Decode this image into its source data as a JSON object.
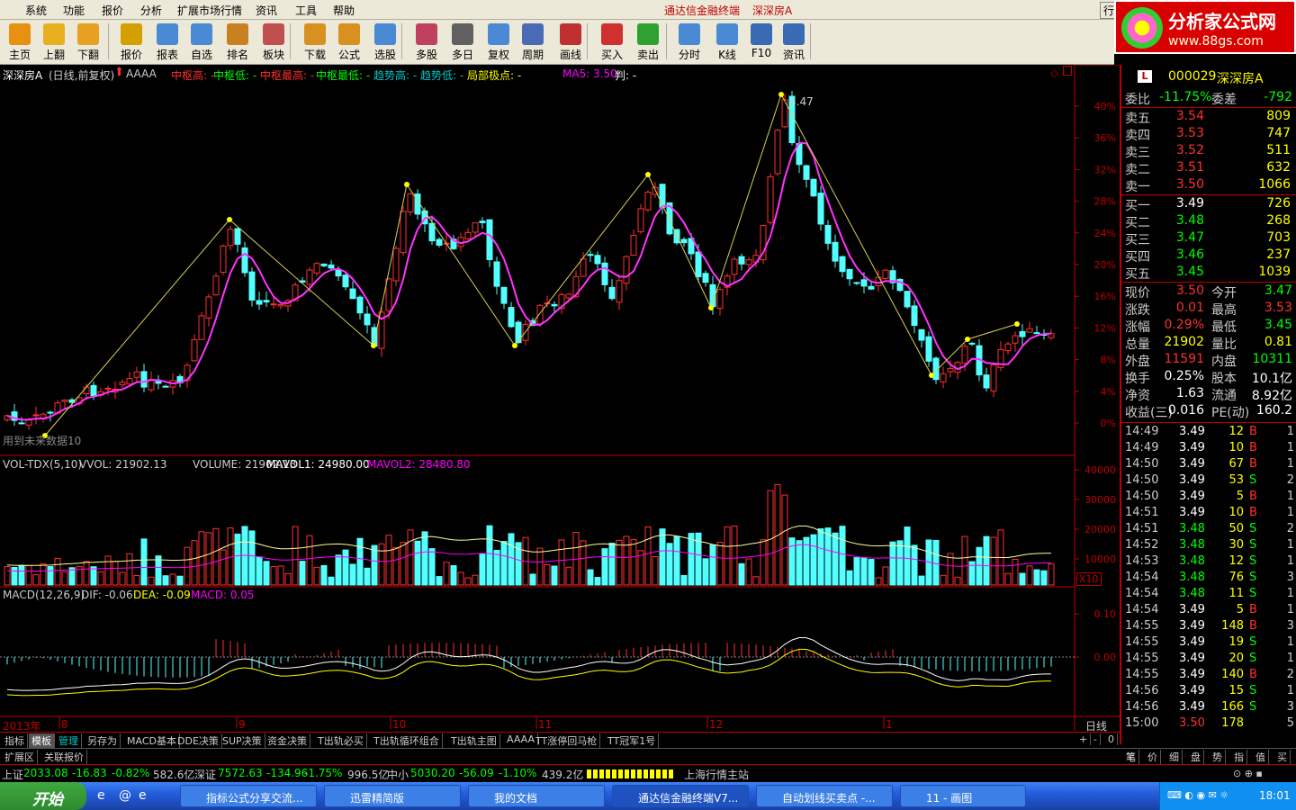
{
  "menu": [
    "系统",
    "功能",
    "报价",
    "分析",
    "扩展市场行情",
    "资讯",
    "工具",
    "帮助"
  ],
  "app_title": "通达信金融终端",
  "stock_title": "深深房A",
  "menu_right": "行",
  "logo": {
    "title": "分析家公式网",
    "url": "www.88gs.com"
  },
  "toolbar": [
    "主页",
    "上翻",
    "下翻",
    "报价",
    "报表",
    "自选",
    "排名",
    "板块",
    "下载",
    "公式",
    "选股",
    "多股",
    "多日",
    "复权",
    "周期",
    "画线",
    "买入",
    "卖出",
    "分时",
    "K线",
    "F10",
    "资讯"
  ],
  "main_chart": {
    "header_stock": "深深房A",
    "header_period": "(日线,前复权)",
    "header_formula": "AAAA",
    "indicators": [
      {
        "label": "中枢高:",
        "value": "-",
        "color": "#ff3030"
      },
      {
        "label": "中枢低:",
        "value": "-",
        "color": "#00ff00"
      },
      {
        "label": "中枢最高:",
        "value": "-",
        "color": "#ff3030"
      },
      {
        "label": "中枢最低:",
        "value": "-",
        "color": "#00ff00"
      },
      {
        "label": "趋势高:",
        "value": "-",
        "color": "#00c8c8"
      },
      {
        "label": "趋势低:",
        "value": "-",
        "color": "#00c8c8"
      },
      {
        "label": "局部极点:",
        "value": "-",
        "color": "#ffff00"
      },
      {
        "label": "MA5:",
        "value": "3.50",
        "color": "#ff00ff"
      },
      {
        "label": "判:",
        "value": "-",
        "color": "#ffffff"
      }
    ],
    "peak_label": "4.47",
    "left_note": "用到未来数据10",
    "y_ticks": [
      "40%",
      "36%",
      "32%",
      "28%",
      "24%",
      "20%",
      "16%",
      "12%",
      "8%",
      "4%",
      "0%"
    ]
  },
  "volume_chart": {
    "title": "VOL-TDX(5,10)",
    "vvol": "VVOL: 21902.13",
    "volume": "VOLUME: 21902.13",
    "mavol1": "MAVOL1: 24980.00",
    "mavol2": "MAVOL2: 28480.80",
    "y_ticks": [
      "40000",
      "30000",
      "20000",
      "10000"
    ],
    "scale": "X10"
  },
  "macd_chart": {
    "title": "MACD(12,26,9)",
    "dif": "DIF: -0.06",
    "dea": "DEA: -0.09",
    "macd": "MACD: 0.05",
    "y_ticks": [
      "0.10",
      "0.00"
    ]
  },
  "x_axis": {
    "year": "2013年",
    "months": [
      "8",
      "9",
      "10",
      "11",
      "12",
      "1"
    ],
    "period": "日线"
  },
  "quote": {
    "code": "000029",
    "name": "深深房A",
    "weibi_label": "委比",
    "weibi": "-11.75%",
    "weicha_label": "委差",
    "weicha": "-792",
    "sells": [
      {
        "label": "卖五",
        "price": "3.54",
        "vol": "809"
      },
      {
        "label": "卖四",
        "price": "3.53",
        "vol": "747"
      },
      {
        "label": "卖三",
        "price": "3.52",
        "vol": "511"
      },
      {
        "label": "卖二",
        "price": "3.51",
        "vol": "632"
      },
      {
        "label": "卖一",
        "price": "3.50",
        "vol": "1066"
      }
    ],
    "buys": [
      {
        "label": "买一",
        "price": "3.49",
        "vol": "726"
      },
      {
        "label": "买二",
        "price": "3.48",
        "vol": "268"
      },
      {
        "label": "买三",
        "price": "3.47",
        "vol": "703"
      },
      {
        "label": "买四",
        "price": "3.46",
        "vol": "237"
      },
      {
        "label": "买五",
        "price": "3.45",
        "vol": "1039"
      }
    ],
    "stats": [
      {
        "l1": "现价",
        "v1": "3.50",
        "c1": "#ff3030",
        "l2": "今开",
        "v2": "3.47",
        "c2": "#00ff00"
      },
      {
        "l1": "涨跌",
        "v1": "0.01",
        "c1": "#ff3030",
        "l2": "最高",
        "v2": "3.53",
        "c2": "#ff3030"
      },
      {
        "l1": "涨幅",
        "v1": "0.29%",
        "c1": "#ff3030",
        "l2": "最低",
        "v2": "3.45",
        "c2": "#00ff00"
      },
      {
        "l1": "总量",
        "v1": "21902",
        "c1": "#ffff00",
        "l2": "量比",
        "v2": "0.81",
        "c2": "#ffff00"
      },
      {
        "l1": "外盘",
        "v1": "11591",
        "c1": "#ff3030",
        "l2": "内盘",
        "v2": "10311",
        "c2": "#00ff00"
      },
      {
        "l1": "换手",
        "v1": "0.25%",
        "c1": "#ffffff",
        "l2": "股本",
        "v2": "10.1亿",
        "c2": "#ffffff"
      },
      {
        "l1": "净资",
        "v1": "1.63",
        "c1": "#ffffff",
        "l2": "流通",
        "v2": "8.92亿",
        "c2": "#ffffff"
      },
      {
        "l1": "收益(三)",
        "v1": "0.016",
        "c1": "#ffffff",
        "l2": "PE(动)",
        "v2": "160.2",
        "c2": "#ffffff"
      }
    ]
  },
  "ticks": [
    {
      "time": "14:49",
      "price": "3.49",
      "vol": "12",
      "bs": "B",
      "n": "1"
    },
    {
      "time": "14:49",
      "price": "3.49",
      "vol": "10",
      "bs": "B",
      "n": "1"
    },
    {
      "time": "14:50",
      "price": "3.49",
      "vol": "67",
      "bs": "B",
      "n": "1"
    },
    {
      "time": "14:50",
      "price": "3.49",
      "vol": "53",
      "bs": "S",
      "n": "2"
    },
    {
      "time": "14:50",
      "price": "3.49",
      "vol": "5",
      "bs": "B",
      "n": "1"
    },
    {
      "time": "14:51",
      "price": "3.49",
      "vol": "10",
      "bs": "B",
      "n": "1"
    },
    {
      "time": "14:51",
      "price": "3.48",
      "vol": "50",
      "bs": "S",
      "n": "2"
    },
    {
      "time": "14:52",
      "price": "3.48",
      "vol": "30",
      "bs": "S",
      "n": "1"
    },
    {
      "time": "14:53",
      "price": "3.48",
      "vol": "12",
      "bs": "S",
      "n": "1"
    },
    {
      "time": "14:54",
      "price": "3.48",
      "vol": "76",
      "bs": "S",
      "n": "3"
    },
    {
      "time": "14:54",
      "price": "3.48",
      "vol": "11",
      "bs": "S",
      "n": "1"
    },
    {
      "time": "14:54",
      "price": "3.49",
      "vol": "5",
      "bs": "B",
      "n": "1"
    },
    {
      "time": "14:55",
      "price": "3.49",
      "vol": "148",
      "bs": "B",
      "n": "3"
    },
    {
      "time": "14:55",
      "price": "3.49",
      "vol": "19",
      "bs": "S",
      "n": "1"
    },
    {
      "time": "14:55",
      "price": "3.49",
      "vol": "20",
      "bs": "S",
      "n": "1"
    },
    {
      "time": "14:55",
      "price": "3.49",
      "vol": "140",
      "bs": "B",
      "n": "2"
    },
    {
      "time": "14:56",
      "price": "3.49",
      "vol": "15",
      "bs": "S",
      "n": "1"
    },
    {
      "time": "14:56",
      "price": "3.49",
      "vol": "166",
      "bs": "S",
      "n": "3"
    },
    {
      "time": "15:00",
      "price": "3.50",
      "vol": "178",
      "bs": "",
      "n": "5"
    }
  ],
  "right_tabs": [
    "笔",
    "价",
    "细",
    "盘",
    "势",
    "指",
    "值",
    "买"
  ],
  "bottom_tabs": [
    "指标",
    "模板",
    "管理",
    "另存为",
    "MACD基本",
    "DDE决策",
    "SUP决策",
    "资金决策",
    "T出轨必买",
    "T出轨循环组合",
    "T出轨主图",
    "AAAA",
    "TT涨停回马枪",
    "TT冠军1号"
  ],
  "bottom_right": [
    "+",
    "-",
    "0"
  ],
  "ext_tabs": [
    "扩展区",
    "关联报价"
  ],
  "status": {
    "sh_label": "上证",
    "sh": "2033.08",
    "sh_chg": "-16.83",
    "sh_pct": "-0.82%",
    "sh_amt": "582.6亿",
    "sz_label": "深证",
    "sz": "7572.63",
    "sz_chg": "-134.96",
    "sz_pct": "-1.75%",
    "sz_amt": "996.5亿",
    "zx_label": "中小",
    "zx": "5030.20",
    "zx_chg": "-56.09",
    "zx_pct": "-1.10%",
    "zx_amt": "439.2亿",
    "station": "上海行情主站"
  },
  "taskbar": {
    "start": "开始",
    "tasks": [
      "指标公式分享交流...",
      "迅雷精简版",
      "我的文档",
      "通达信金融终端V7...",
      "自动划线买卖点 -...",
      "11 - 画图"
    ],
    "clock": "18:01"
  }
}
